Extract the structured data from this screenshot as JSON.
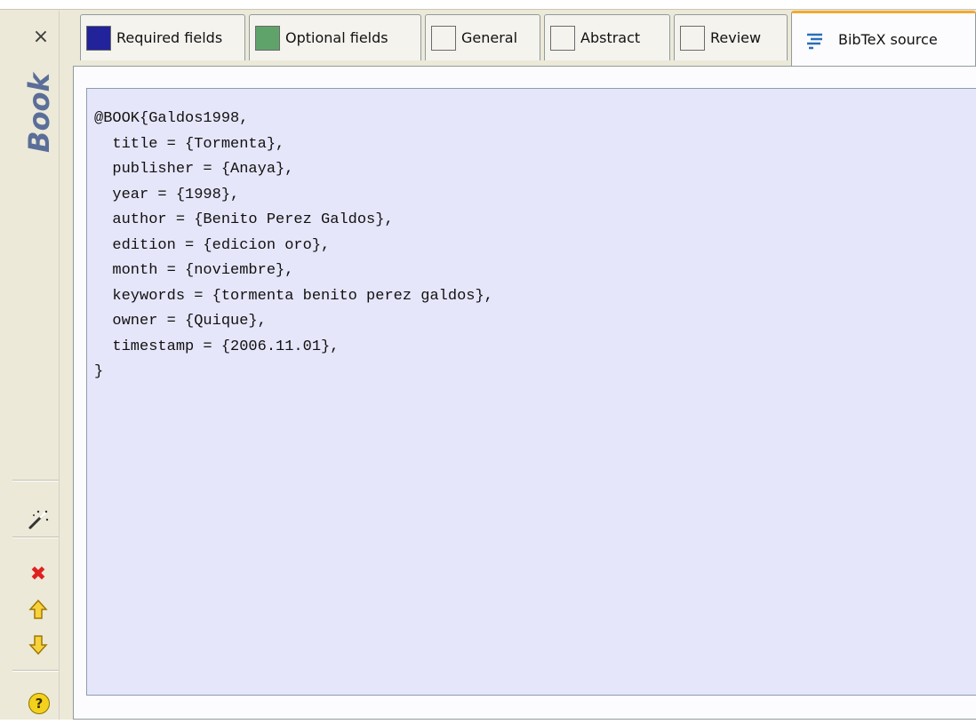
{
  "sidebar": {
    "close_glyph": "×",
    "entry_type": "Book",
    "icons": {
      "close": "close-icon",
      "cleanup": "magic-wand-icon",
      "delete": "delete-icon",
      "move_up": "arrow-up-icon",
      "move_down": "arrow-down-icon",
      "help": "help-icon"
    },
    "help_glyph": "?"
  },
  "tabs": [
    {
      "label": "Required fields",
      "swatch": "#22229a"
    },
    {
      "label": "Optional fields",
      "swatch": "#5fa36a"
    },
    {
      "label": "General",
      "swatch": "#f4f3ee"
    },
    {
      "label": "Abstract",
      "swatch": "#f4f3ee"
    },
    {
      "label": "Review",
      "swatch": "#f4f3ee"
    },
    {
      "label": "BibTeX source",
      "active": true
    }
  ],
  "bibtex": {
    "lines": [
      "@BOOK{Galdos1998,",
      "  title = {Tormenta},",
      "  publisher = {Anaya},",
      "  year = {1998},",
      "  author = {Benito Perez Galdos},",
      "  edition = {edicion oro},",
      "  month = {noviembre},",
      "  keywords = {tormenta benito perez galdos},",
      "  owner = {Quique},",
      "  timestamp = {2006.11.01},",
      "}"
    ]
  },
  "colors": {
    "editor_bg": "#e6e6fa",
    "active_tab_accent": "#f4a830",
    "type_label": "#5b6e99"
  }
}
